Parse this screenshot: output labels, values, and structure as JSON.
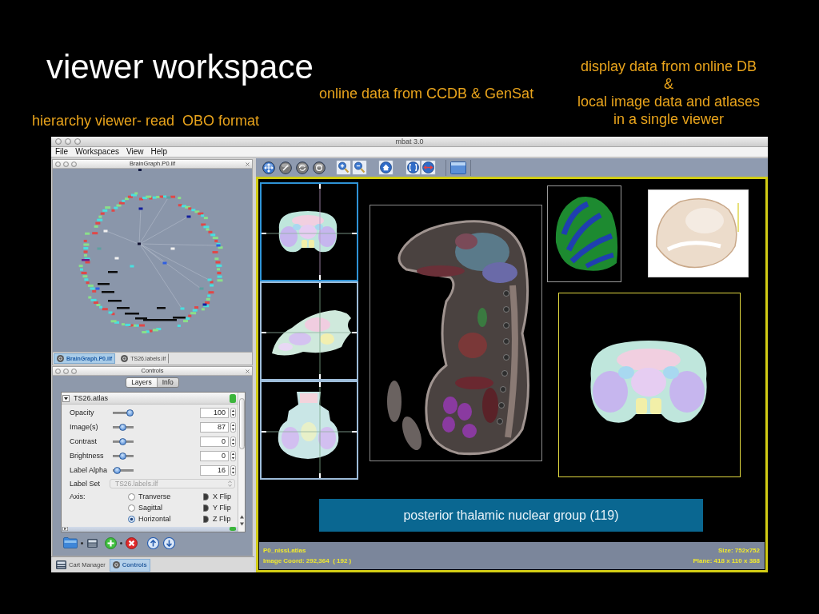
{
  "slide": {
    "title": "viewer workspace",
    "caption_right": [
      "display data from online DB",
      "&",
      "local image data and atlases",
      "in a single viewer"
    ],
    "caption_middle": "online data from CCDB & GenSat",
    "caption_left": "hierarchy viewer- read  OBO format"
  },
  "window": {
    "title": "mbat 3.0",
    "menu": [
      "File",
      "Workspaces",
      "View",
      "Help"
    ]
  },
  "graph_panel": {
    "title": "BrainGraph.P0.ilf",
    "tabs": [
      {
        "label": "BrainGraph.P0.ilf",
        "selected": true
      },
      {
        "label": "TS26.labels.ilf",
        "selected": false
      }
    ]
  },
  "controls_panel": {
    "title": "Controls",
    "tabs": [
      {
        "label": "Layers",
        "selected": true
      },
      {
        "label": "Info",
        "selected": false
      }
    ],
    "layers": [
      {
        "name": "TS26.atlas",
        "expanded": true,
        "visible": true,
        "sliders": [
          {
            "label": "Opacity",
            "level": 1,
            "value": "100"
          },
          {
            "label": "Image(s)",
            "level": 0.45,
            "value": "87"
          },
          {
            "label": "Contrast",
            "level": 0.45,
            "value": "0"
          },
          {
            "label": "Brightness",
            "level": 0.45,
            "value": "0"
          },
          {
            "label": "Label Alpha",
            "level": 0.05,
            "value": "16"
          }
        ],
        "label_set": {
          "label": "Label Set",
          "value": "TS26.labels.ilf",
          "disabled": true
        },
        "axis": {
          "label": "Axis:",
          "options": [
            {
              "label": "Tranverse",
              "selected": false
            },
            {
              "label": "Sagittal",
              "selected": false
            },
            {
              "label": "Horizontal",
              "selected": true
            }
          ]
        },
        "flips": [
          {
            "label": "X Flip",
            "checked": false
          },
          {
            "label": "Y Flip",
            "checked": false
          },
          {
            "label": "Z Flip",
            "checked": false
          }
        ]
      },
      {
        "expanded": false,
        "visible": true
      }
    ]
  },
  "dock_tabs": [
    {
      "label": "Cart Manager",
      "selected": false
    },
    {
      "label": "Controls",
      "selected": true
    }
  ],
  "viewer": {
    "thumbnails": [
      {
        "selected": true
      },
      {
        "selected": false
      },
      {
        "selected": false
      }
    ],
    "structure_label": "posterior thalamic nuclear group (119)",
    "status": {
      "left": [
        "P0_nissLatlas",
        "Image Coord: 292,364  ( 192 )"
      ],
      "right": [
        "Size: 752x752",
        "Plane: 418 x 110 x 388"
      ]
    }
  }
}
